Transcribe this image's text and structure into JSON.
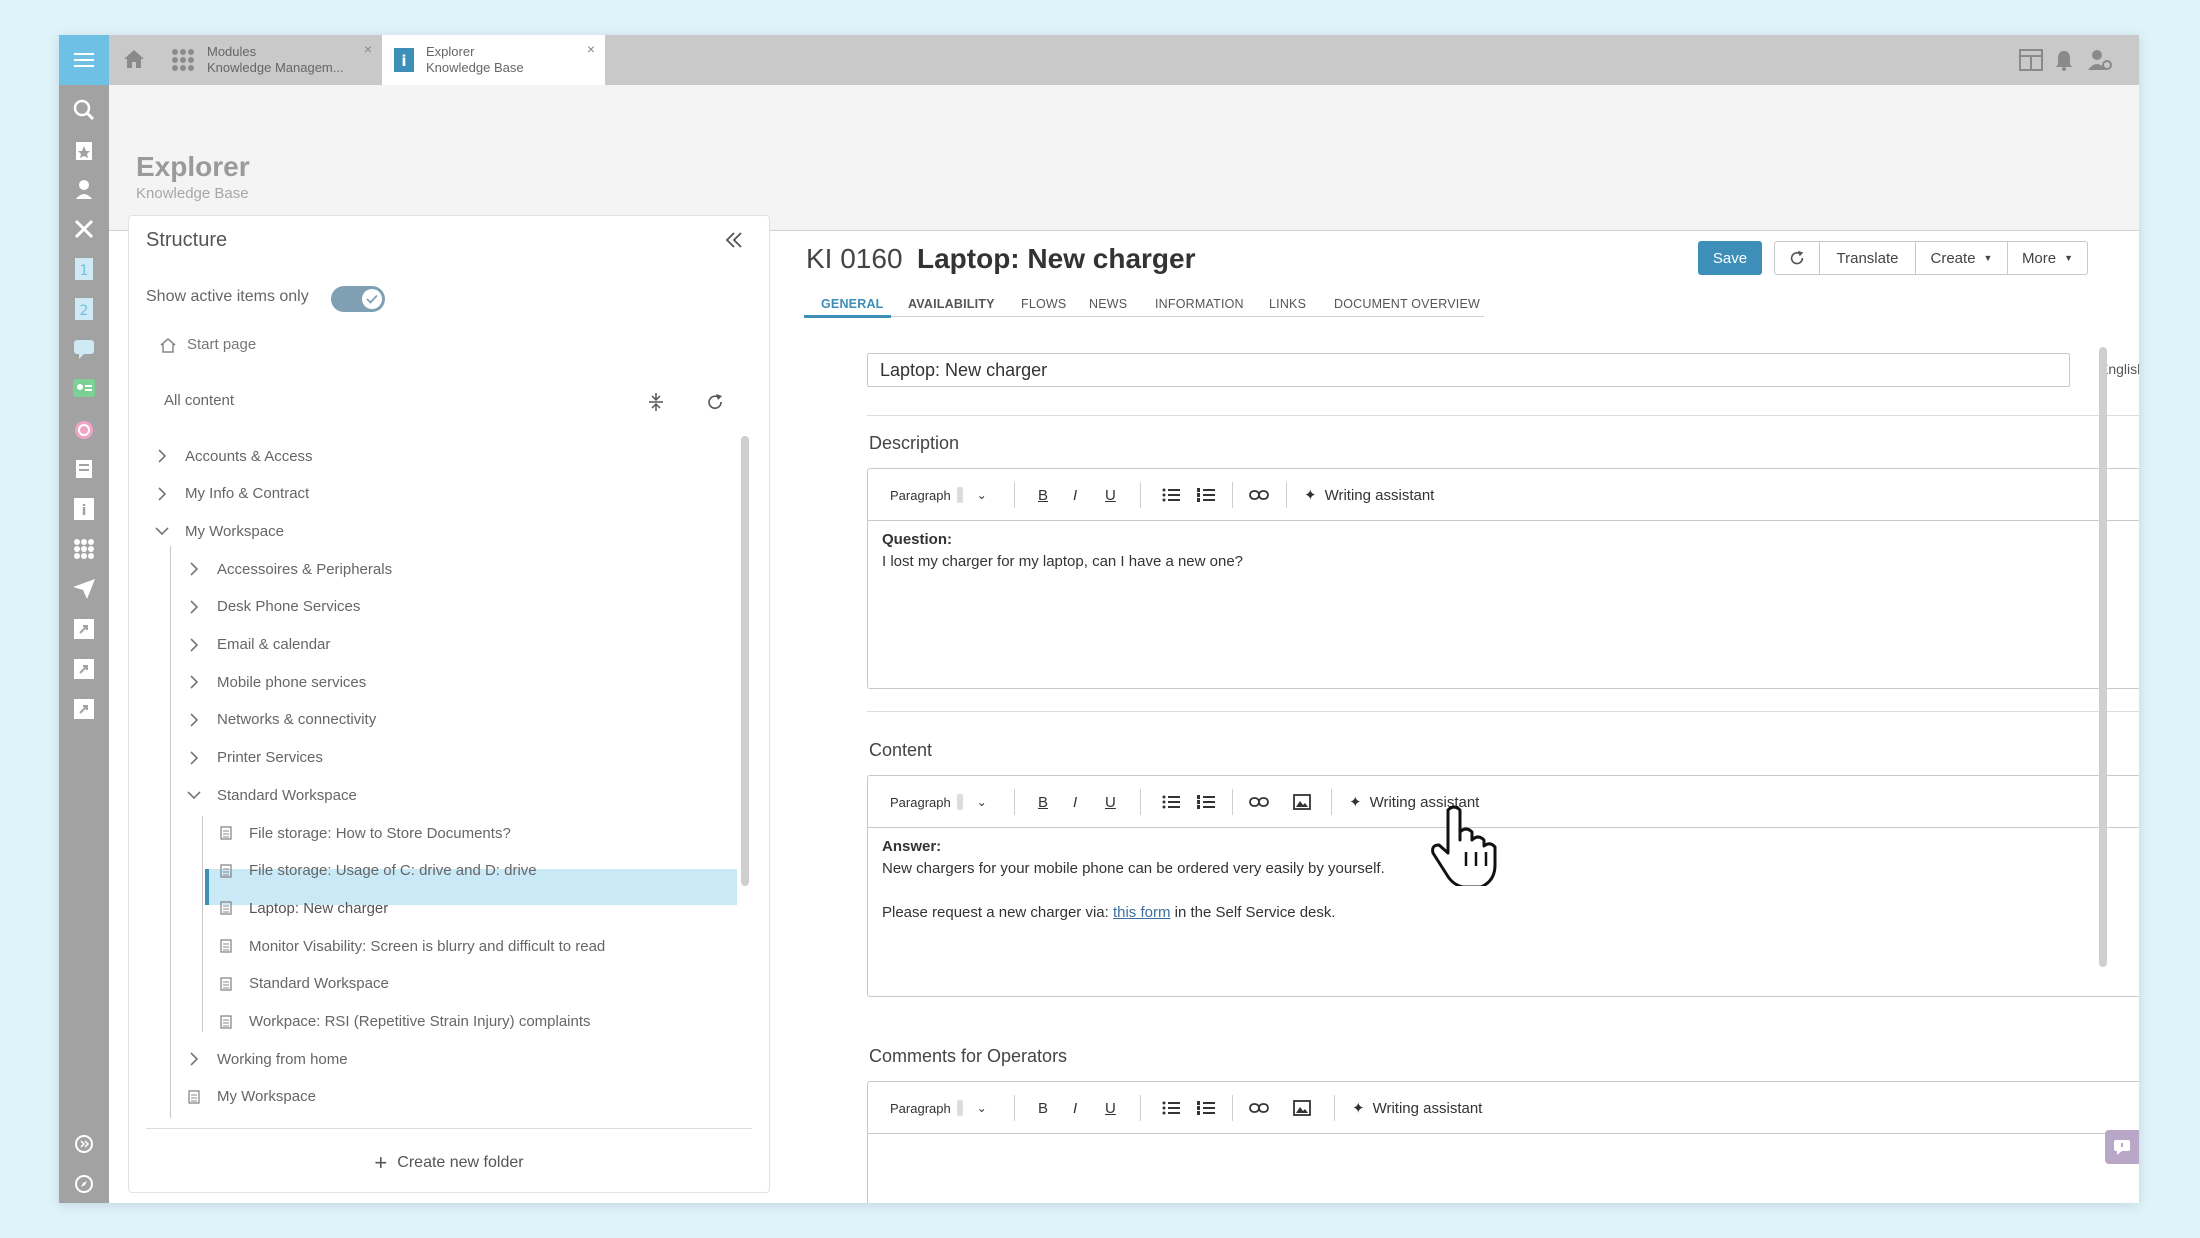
{
  "tabs": [
    {
      "line1": "Modules",
      "line2": "Knowledge Managem..."
    },
    {
      "line1": "Explorer",
      "line2": "Knowledge Base"
    }
  ],
  "header": {
    "title": "Explorer",
    "subtitle": "Knowledge Base"
  },
  "structure": {
    "title": "Structure",
    "toggle_label": "Show active items only",
    "toggle_on": true,
    "start_page": "Start page",
    "all_content": "All content",
    "create_folder": "Create new folder",
    "items": [
      {
        "label": "Accounts & Access",
        "level": 0,
        "kind": "folder",
        "open": false
      },
      {
        "label": "My Info & Contract",
        "level": 0,
        "kind": "folder",
        "open": false
      },
      {
        "label": "My Workspace",
        "level": 0,
        "kind": "folder",
        "open": true
      },
      {
        "label": "Accessoires & Peripherals",
        "level": 1,
        "kind": "folder",
        "open": false
      },
      {
        "label": "Desk Phone Services",
        "level": 1,
        "kind": "folder",
        "open": false
      },
      {
        "label": "Email & calendar",
        "level": 1,
        "kind": "folder",
        "open": false
      },
      {
        "label": "Mobile phone services",
        "level": 1,
        "kind": "folder",
        "open": false
      },
      {
        "label": "Networks & connectivity",
        "level": 1,
        "kind": "folder",
        "open": false
      },
      {
        "label": "Printer Services",
        "level": 1,
        "kind": "folder",
        "open": false
      },
      {
        "label": "Standard Workspace",
        "level": 1,
        "kind": "folder",
        "open": true
      },
      {
        "label": "File storage: How to Store Documents?",
        "level": 2,
        "kind": "doc"
      },
      {
        "label": "File storage: Usage of C: drive and D: drive",
        "level": 2,
        "kind": "doc"
      },
      {
        "label": "Laptop: New charger",
        "level": 2,
        "kind": "doc",
        "selected": true
      },
      {
        "label": "Monitor Visability: Screen is blurry and difficult to read",
        "level": 2,
        "kind": "doc"
      },
      {
        "label": "Standard Workspace",
        "level": 2,
        "kind": "doc"
      },
      {
        "label": "Workpace: RSI (Repetitive Strain Injury) complaints",
        "level": 2,
        "kind": "doc"
      },
      {
        "label": "Working from home",
        "level": 1,
        "kind": "folder",
        "open": false
      },
      {
        "label": "My Workspace",
        "level": 1,
        "kind": "doc"
      }
    ]
  },
  "item": {
    "id": "KI 0160",
    "title": "Laptop: New charger",
    "save": "Save",
    "translate": "Translate",
    "create": "Create",
    "more": "More",
    "tabs": [
      "GENERAL",
      "AVAILABILITY",
      "FLOWS",
      "NEWS",
      "INFORMATION",
      "LINKS",
      "DOCUMENT OVERVIEW"
    ],
    "title_value": "Laptop: New charger",
    "language": "English"
  },
  "editor": {
    "paragraph": "Paragraph",
    "writing_assistant": "Writing assistant"
  },
  "description": {
    "label": "Description",
    "question_label": "Question:",
    "question_text": "I lost my charger for my laptop, can I have a new one?"
  },
  "content": {
    "label": "Content",
    "answer_label": "Answer:",
    "line1": "New chargers for your mobile phone can be ordered very easily by yourself.",
    "line2_before": "Please request a new charger via: ",
    "line2_link": "this form",
    "line2_after": " in the Self Service desk."
  },
  "comments": {
    "label": "Comments for Operators"
  },
  "colors": {
    "accent": "#3d8eb9",
    "selected": "#c9e9f6",
    "rail": "#a2a2a2",
    "rail_top": "#6ec1e4"
  }
}
